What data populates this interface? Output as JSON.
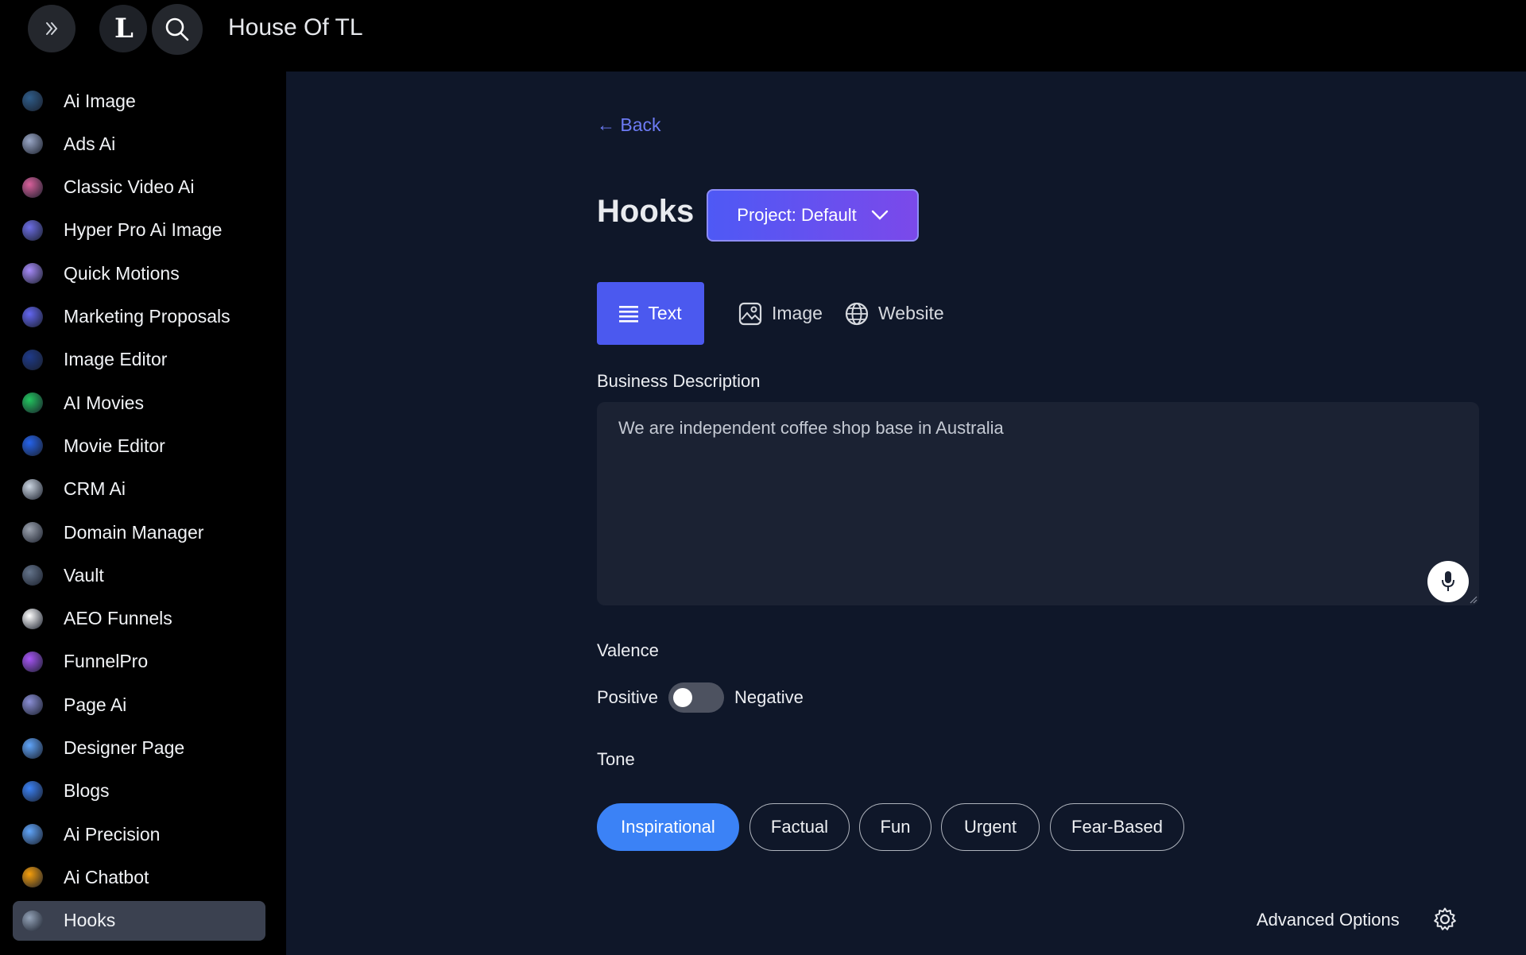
{
  "app": {
    "title": "House Of TL",
    "logo_letter": "L"
  },
  "sidebar": {
    "items": [
      {
        "label": "Ai Image",
        "icon": "ai-image-icon",
        "color": "#2f5d8a"
      },
      {
        "label": "Ads Ai",
        "icon": "ads-ai-icon",
        "color": "#9aa7c6"
      },
      {
        "label": "Classic Video Ai",
        "icon": "classic-video-icon",
        "color": "#d9609b"
      },
      {
        "label": "Hyper Pro Ai Image",
        "icon": "hyper-pro-icon",
        "color": "#6d6ee6"
      },
      {
        "label": "Quick Motions",
        "icon": "quick-motions-icon",
        "color": "#a78bfa"
      },
      {
        "label": "Marketing Proposals",
        "icon": "marketing-proposals-icon",
        "color": "#6366f1"
      },
      {
        "label": "Image Editor",
        "icon": "image-editor-icon",
        "color": "#1e3a8a"
      },
      {
        "label": "AI Movies",
        "icon": "ai-movies-icon",
        "color": "#22c55e"
      },
      {
        "label": "Movie Editor",
        "icon": "movie-editor-icon",
        "color": "#2563eb"
      },
      {
        "label": "CRM Ai",
        "icon": "crm-ai-icon",
        "color": "#cbd5e1"
      },
      {
        "label": "Domain Manager",
        "icon": "domain-manager-icon",
        "color": "#9ca3af"
      },
      {
        "label": "Vault",
        "icon": "vault-icon",
        "color": "#64748b"
      },
      {
        "label": "AEO Funnels",
        "icon": "aeo-funnels-icon",
        "color": "#ffffff"
      },
      {
        "label": "FunnelPro",
        "icon": "funnelpro-icon",
        "color": "#a855f7"
      },
      {
        "label": "Page Ai",
        "icon": "page-ai-icon",
        "color": "#8b8fd6"
      },
      {
        "label": "Designer Page",
        "icon": "designer-page-icon",
        "color": "#60a5fa"
      },
      {
        "label": "Blogs",
        "icon": "blogs-icon",
        "color": "#3b82f6"
      },
      {
        "label": "Ai Precision",
        "icon": "ai-precision-icon",
        "color": "#60a5fa"
      },
      {
        "label": "Ai Chatbot",
        "icon": "ai-chatbot-icon",
        "color": "#f59e0b"
      },
      {
        "label": "Hooks",
        "icon": "hooks-icon",
        "color": "#94a3b8"
      }
    ]
  },
  "main": {
    "back_label": "← Back",
    "page_title": "Hooks",
    "project_button": "Project: Default",
    "tabs": [
      {
        "label": "Text",
        "icon": "text-lines-icon",
        "active": true
      },
      {
        "label": "Image",
        "icon": "image-icon",
        "active": false
      },
      {
        "label": "Website",
        "icon": "globe-icon",
        "active": false
      }
    ],
    "description": {
      "label": "Business Description",
      "value": "We are independent coffee shop base in Australia"
    },
    "valence": {
      "label": "Valence",
      "left": "Positive",
      "right": "Negative",
      "is_negative": false
    },
    "tone": {
      "label": "Tone",
      "options": [
        "Inspirational",
        "Factual",
        "Fun",
        "Urgent",
        "Fear-Based"
      ],
      "selected": "Inspirational"
    },
    "advanced_options": "Advanced Options"
  },
  "colors": {
    "main_bg": "#0f1729",
    "accent_blue": "#4b59ef",
    "chip_active": "#3b82f6",
    "link": "#6d7bf5"
  }
}
